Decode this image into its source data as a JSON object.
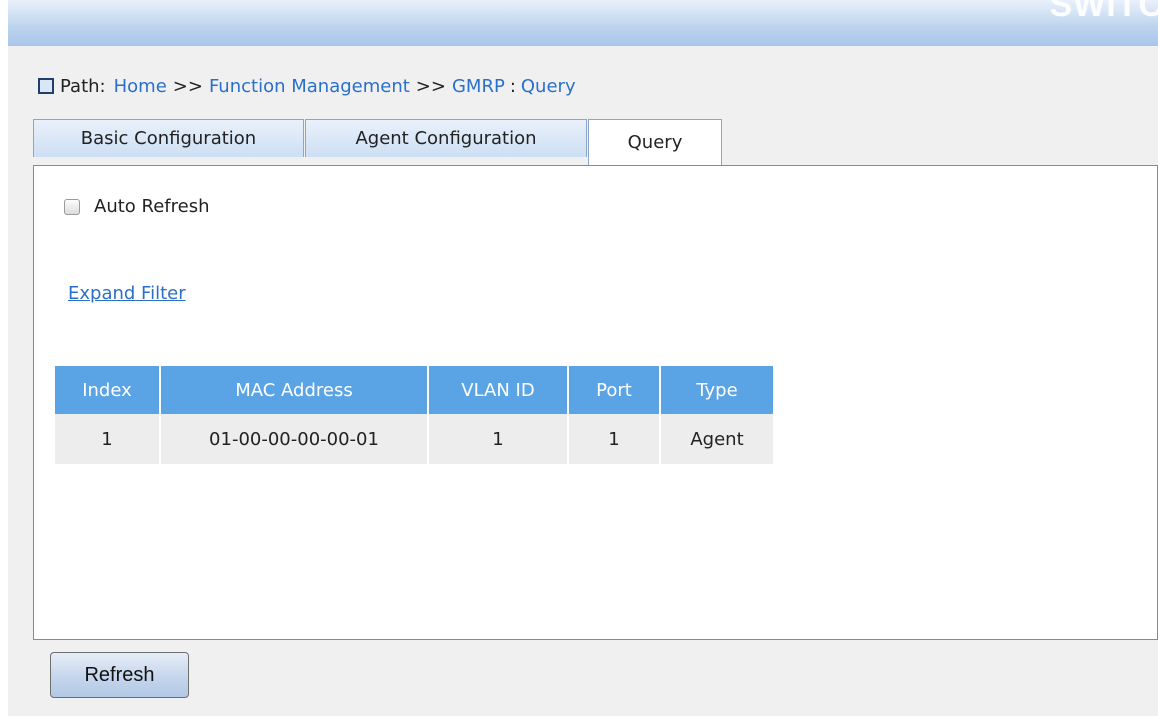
{
  "header": {
    "banner_text": "SWITC"
  },
  "path": {
    "label": "Path:",
    "crumbs": [
      "Home",
      "Function Management",
      "GMRP"
    ],
    "separator": ">>",
    "current_sep": ":",
    "current": "Query"
  },
  "tabs": [
    {
      "label": "Basic Configuration",
      "active": false
    },
    {
      "label": "Agent Configuration",
      "active": false
    },
    {
      "label": "Query",
      "active": true
    }
  ],
  "panel": {
    "auto_refresh_label": "Auto Refresh",
    "auto_refresh_checked": false,
    "expand_filter_label": "Expand Filter"
  },
  "table": {
    "columns": [
      "Index",
      "MAC Address",
      "VLAN ID",
      "Port",
      "Type"
    ],
    "rows": [
      [
        "1",
        "01-00-00-00-00-01",
        "1",
        "1",
        "Agent"
      ]
    ]
  },
  "buttons": {
    "refresh_label": "Refresh"
  },
  "colors": {
    "header_blue": "#5aa4e6",
    "link_blue": "#2a6fc9",
    "row_gray": "#ededed",
    "page_gray": "#f0f0f0"
  }
}
